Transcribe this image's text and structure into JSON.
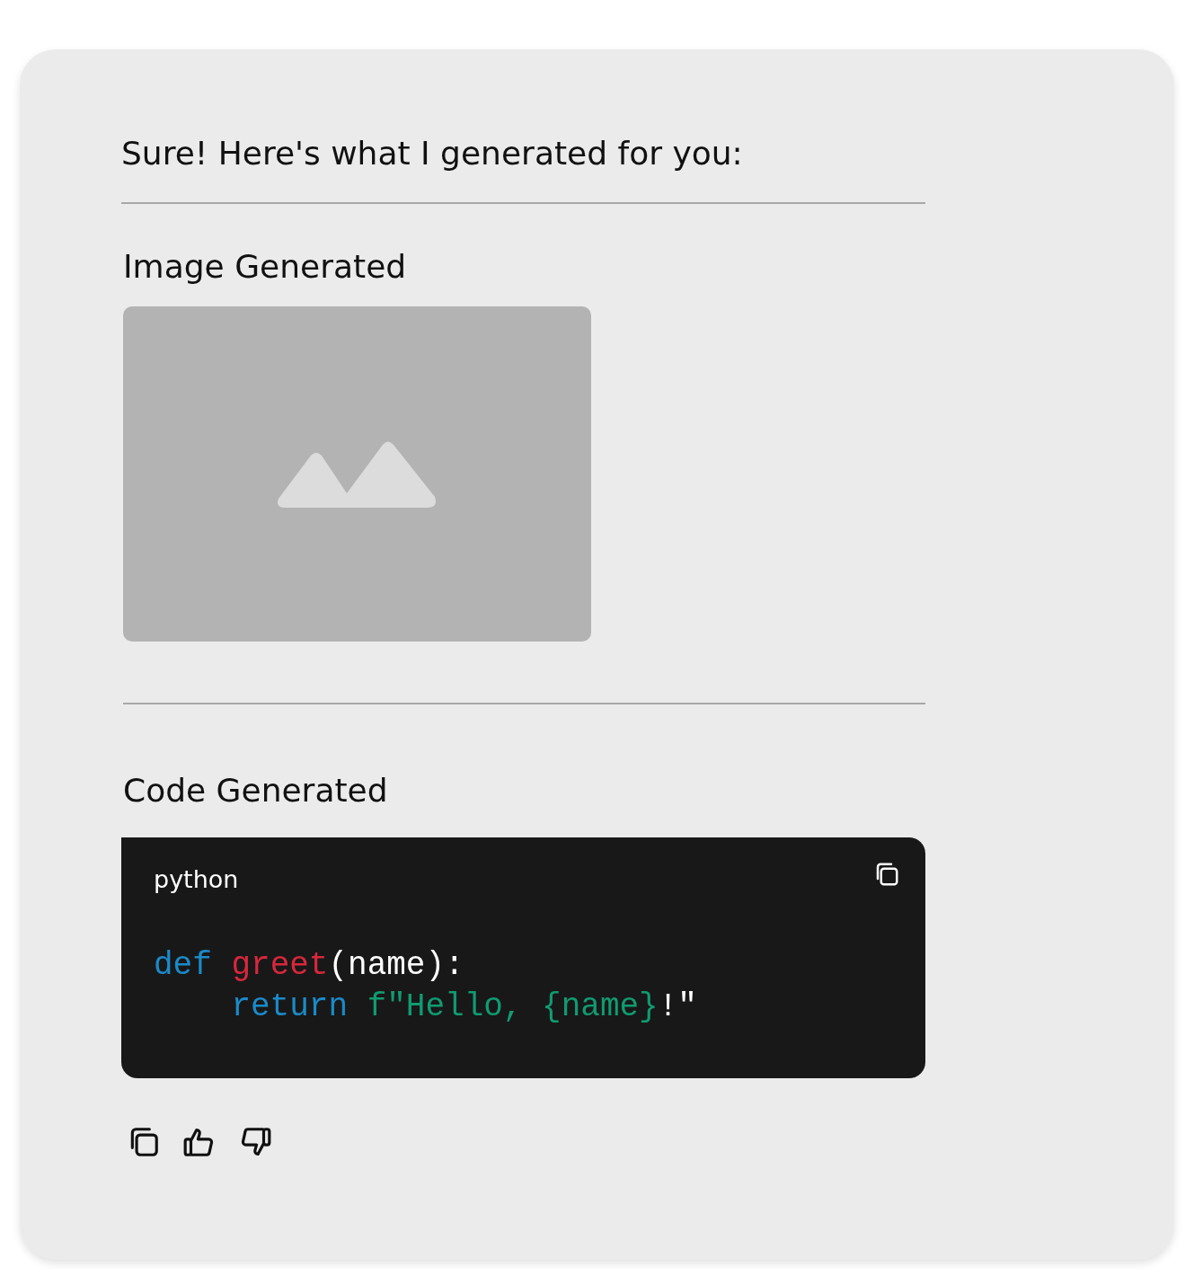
{
  "message": {
    "intro": "Sure! Here's what I generated for you:",
    "image_section": {
      "heading": "Image Generated",
      "image": {
        "kind": "placeholder"
      }
    },
    "code_section": {
      "heading": "Code Generated",
      "language": "python",
      "lines": [
        {
          "indented": false,
          "tokens": [
            {
              "kind": "keyword",
              "text": "def",
              "spaced": false
            },
            {
              "kind": "function",
              "text": "greet",
              "spaced": true
            },
            {
              "kind": "plain",
              "text": "(name):",
              "spaced": false
            }
          ]
        },
        {
          "indented": true,
          "tokens": [
            {
              "kind": "keyword",
              "text": "return",
              "spaced": false
            },
            {
              "kind": "string",
              "text": "f\"Hello, {name}",
              "spaced": true
            },
            {
              "kind": "plain",
              "text": "!\"",
              "spaced": false
            }
          ]
        }
      ]
    },
    "actions": [
      {
        "kind": "copy"
      },
      {
        "kind": "like"
      },
      {
        "kind": "dislike"
      }
    ]
  }
}
